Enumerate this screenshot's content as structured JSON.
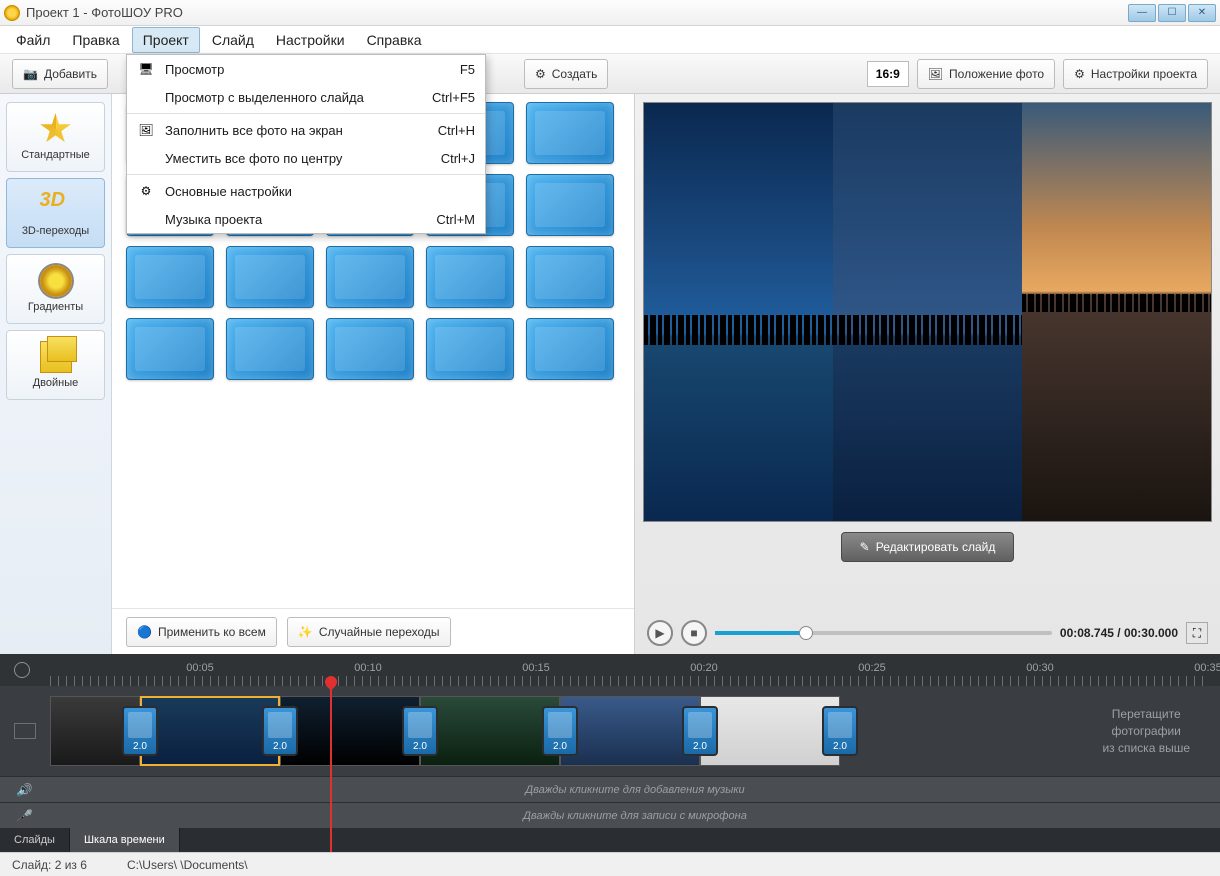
{
  "titlebar": {
    "title": "Проект 1 - ФотоШОУ PRO"
  },
  "menubar": {
    "items": [
      "Файл",
      "Правка",
      "Проект",
      "Слайд",
      "Настройки",
      "Справка"
    ],
    "active_index": 2
  },
  "dropdown": {
    "groups": [
      [
        {
          "label": "Просмотр",
          "shortcut": "F5",
          "icon": "monitor"
        },
        {
          "label": "Просмотр с выделенного слайда",
          "shortcut": "Ctrl+F5",
          "icon": ""
        }
      ],
      [
        {
          "label": "Заполнить все фото на экран",
          "shortcut": "Ctrl+H",
          "icon": "photo"
        },
        {
          "label": "Уместить все фото по центру",
          "shortcut": "Ctrl+J",
          "icon": ""
        }
      ],
      [
        {
          "label": "Основные настройки",
          "shortcut": "",
          "icon": "gear"
        },
        {
          "label": "Музыка проекта",
          "shortcut": "Ctrl+M",
          "icon": ""
        }
      ]
    ]
  },
  "toolbar": {
    "add": "Добавить",
    "create": "Создать",
    "aspect": "16:9",
    "photo_pos": "Положение фото",
    "proj_settings": "Настройки проекта"
  },
  "categories": [
    {
      "label": "Стандартные",
      "icon": "star"
    },
    {
      "label": "3D-переходы",
      "icon": "3d"
    },
    {
      "label": "Градиенты",
      "icon": "grad"
    },
    {
      "label": "Двойные",
      "icon": "dbl"
    }
  ],
  "categories_active_index": 1,
  "transitions_count": 20,
  "mid_actions": {
    "apply_all": "Применить ко всем",
    "random": "Случайные переходы"
  },
  "preview": {
    "edit_slide": "Редактировать слайд",
    "time": "00:08.745 / 00:30.000"
  },
  "ruler": {
    "marks": [
      "00:05",
      "00:10",
      "00:15",
      "00:20",
      "00:25",
      "00:30",
      "00:35"
    ]
  },
  "timeline": {
    "transitions_duration": "2.0",
    "drag_hint_line1": "Перетащите",
    "drag_hint_line2": "фотографии",
    "drag_hint_line3": "из списка выше",
    "music_hint": "Дважды кликните для добавления музыки",
    "mic_hint": "Дважды кликните для записи с микрофона",
    "tabs": [
      "Слайды",
      "Шкала времени"
    ],
    "tabs_active_index": 1
  },
  "statusbar": {
    "slide": "Слайд: 2 из 6",
    "path": "C:\\Users\\        \\Documents\\"
  }
}
